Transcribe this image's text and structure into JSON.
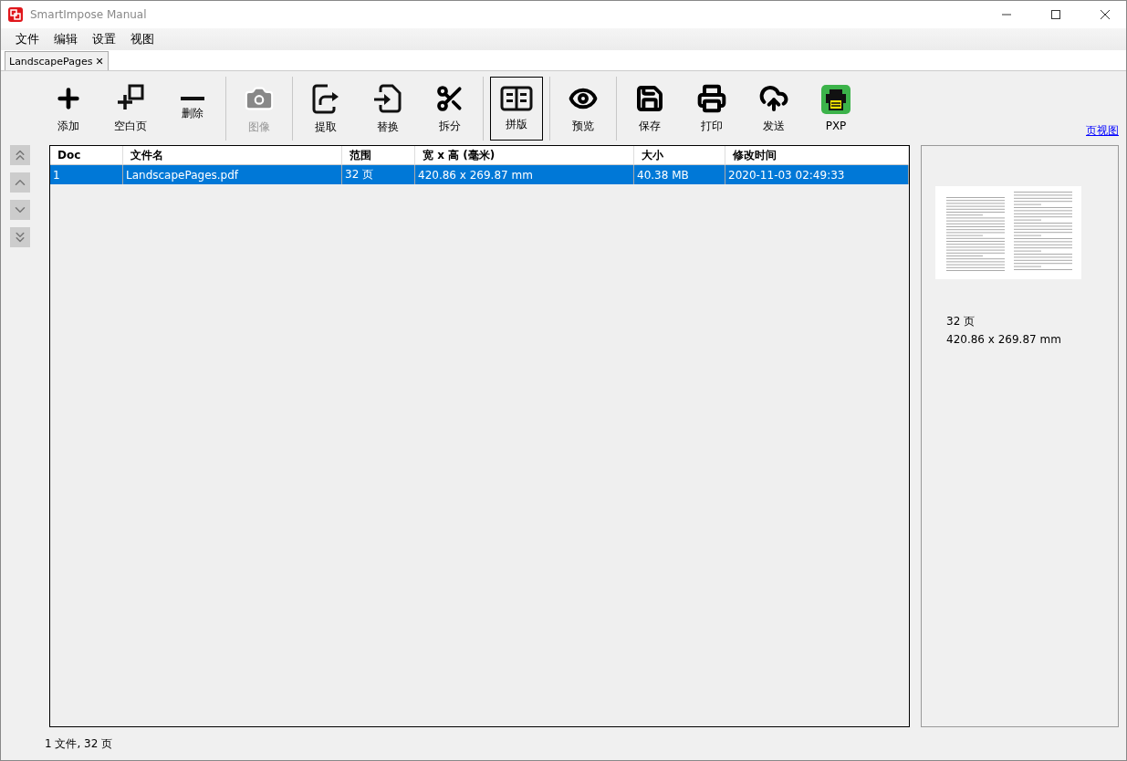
{
  "window": {
    "title": "SmartImpose Manual"
  },
  "menu": [
    "文件",
    "编辑",
    "设置",
    "视图"
  ],
  "tabs": [
    {
      "label": "LandscapePages",
      "close": "✕",
      "selected": true
    }
  ],
  "toolbar": [
    [
      {
        "label": "添加",
        "disabled": false,
        "pressed": false
      },
      {
        "label": "空白页",
        "disabled": false,
        "pressed": false
      },
      {
        "label": "删除",
        "disabled": false,
        "pressed": false
      }
    ],
    [
      {
        "label": "图像",
        "disabled": true,
        "pressed": false
      }
    ],
    [
      {
        "label": "提取",
        "disabled": false,
        "pressed": false
      },
      {
        "label": "替换",
        "disabled": false,
        "pressed": false
      },
      {
        "label": "拆分",
        "disabled": false,
        "pressed": false
      }
    ],
    [
      {
        "label": "拼版",
        "disabled": false,
        "pressed": true
      }
    ],
    [
      {
        "label": "预览",
        "disabled": false,
        "pressed": false
      }
    ],
    [
      {
        "label": "保存",
        "disabled": false,
        "pressed": false
      },
      {
        "label": "打印",
        "disabled": false,
        "pressed": false
      },
      {
        "label": "发送",
        "disabled": false,
        "pressed": false
      },
      {
        "label": "PXP",
        "disabled": false,
        "pressed": false
      }
    ]
  ],
  "page_view_link": "页视图",
  "table": {
    "columns": [
      "Doc",
      "文件名",
      "范围",
      "宽 x 高 (毫米)",
      "大小",
      "修改时间"
    ],
    "rows": [
      {
        "selected": true,
        "cells": [
          "1",
          "LandscapePages.pdf",
          "32 页",
          "420.86 x 269.87 mm",
          "40.38 MB",
          "2020-11-03 02:49:33"
        ]
      }
    ]
  },
  "preview": {
    "pages": "32 页",
    "size": "420.86 x 269.87 mm"
  },
  "status_bar": "1 文件, 32 页"
}
